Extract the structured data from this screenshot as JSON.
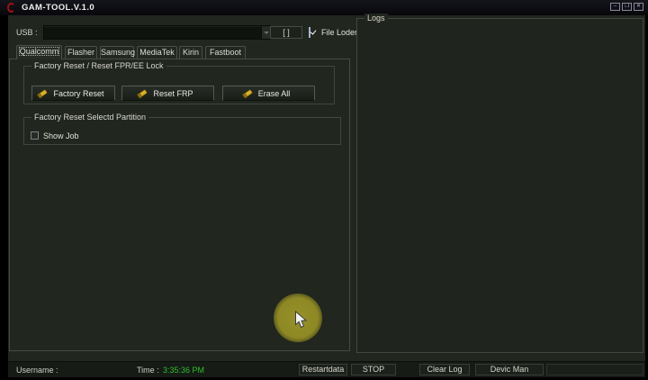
{
  "window": {
    "title": "GAM-TOOL.V.1.0",
    "controls": {
      "minimize": "–",
      "maximize": "❐",
      "close": "✕"
    }
  },
  "usb": {
    "label": "USB :",
    "value": "",
    "bracket_button": "[ ]",
    "file_loader_label": "File Loder",
    "file_loader_checked": true
  },
  "tabs": [
    {
      "label": "Qualcomm",
      "active": true
    },
    {
      "label": "Flasher",
      "active": false
    },
    {
      "label": "Samsung",
      "active": false
    },
    {
      "label": "MediaTek",
      "active": false
    },
    {
      "label": "Kirin",
      "active": false
    },
    {
      "label": "Fastboot",
      "active": false
    }
  ],
  "factory_group": {
    "title": "Factory Reset / Reset FPR/EE Lock",
    "buttons": [
      {
        "label": "Factory Reset",
        "icon": "eraser-icon"
      },
      {
        "label": "Reset FRP",
        "icon": "eraser-icon"
      },
      {
        "label": "Erase All",
        "icon": "eraser-icon"
      }
    ]
  },
  "partition_group": {
    "title": "Factory Reset Selectd Partition",
    "show_job_label": "Show Job",
    "show_job_checked": false
  },
  "logs": {
    "title": "Logs",
    "content": ""
  },
  "statusbar": {
    "username_label": "Username :",
    "time_label": "Time :",
    "time_value": "3:35:36 PM",
    "buttons": [
      "Restartdata",
      "STOP",
      "Clear Log",
      "Devic Man"
    ]
  },
  "colors": {
    "client_bg": "#21261f",
    "panel_border": "#41463f",
    "accent_gold": "#d9b02c",
    "time_green": "#2fbf2f",
    "checkbox_blue": "#2a62a6",
    "logo_red": "#9b1313"
  }
}
